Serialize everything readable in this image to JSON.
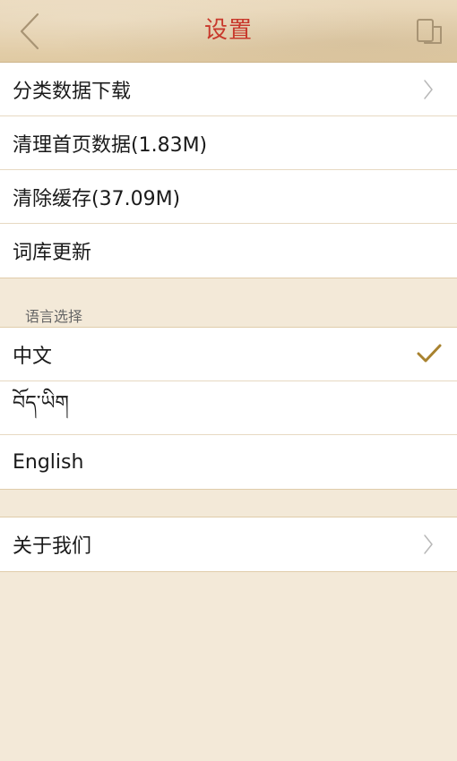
{
  "header": {
    "title": "设置",
    "back_icon": "chevron-left-icon",
    "copy_icon": "copy-icon"
  },
  "settings": {
    "items": [
      {
        "label": "分类数据下载",
        "icon": "chevron-right-icon"
      },
      {
        "label": "清理首页数据(1.83M)"
      },
      {
        "label": "清除缓存(37.09M)"
      },
      {
        "label": "词库更新"
      }
    ]
  },
  "language": {
    "section_label": "语言选择",
    "options": [
      {
        "label": "中文",
        "selected": true
      },
      {
        "label": "བོད་ཡིག",
        "selected": false
      },
      {
        "label": "English",
        "selected": false
      }
    ],
    "selected_icon": "checkmark-icon"
  },
  "about": {
    "label": "关于我们",
    "icon": "chevron-right-icon"
  },
  "colors": {
    "title": "#c8382b",
    "check": "#a8822f",
    "background": "#f3e9d8"
  }
}
